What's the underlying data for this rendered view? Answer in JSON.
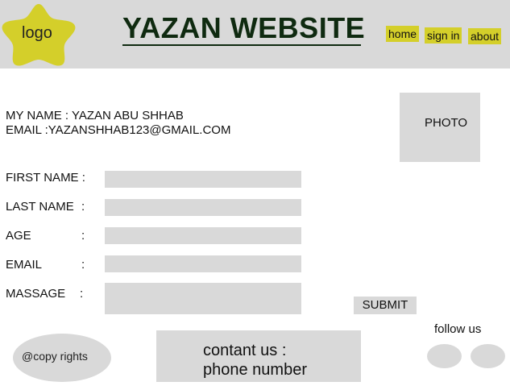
{
  "header": {
    "logo_text": "logo",
    "title": "YAZAN WEBSITE",
    "nav": {
      "home": "home",
      "sign_in": "sign in",
      "about": "about"
    }
  },
  "profile": {
    "name_line": "MY NAME : YAZAN ABU SHHAB",
    "email_line": "EMAIL :YAZANSHHAB123@GMAIL.COM",
    "photo_label": "PHOTO"
  },
  "form": {
    "fields": [
      {
        "label": "FIRST NAME :",
        "colon": "",
        "value": ""
      },
      {
        "label": "LAST NAME",
        "colon": ":",
        "value": ""
      },
      {
        "label": "AGE",
        "colon": ":",
        "value": ""
      },
      {
        "label": "EMAIL",
        "colon": ":",
        "value": ""
      },
      {
        "label": "MASSAGE",
        "colon": ":",
        "value": ""
      }
    ],
    "submit_label": "SUBMIT"
  },
  "footer": {
    "copyright": "@copy rights",
    "contact_line1": "contant us :",
    "contact_line2": "phone number",
    "follow_label": "follow us"
  },
  "colors": {
    "header_bg": "#d9d9d9",
    "accent_yellow": "#d4cf2a",
    "title_green": "#0f2a10",
    "field_gray": "#d9d9d9"
  }
}
